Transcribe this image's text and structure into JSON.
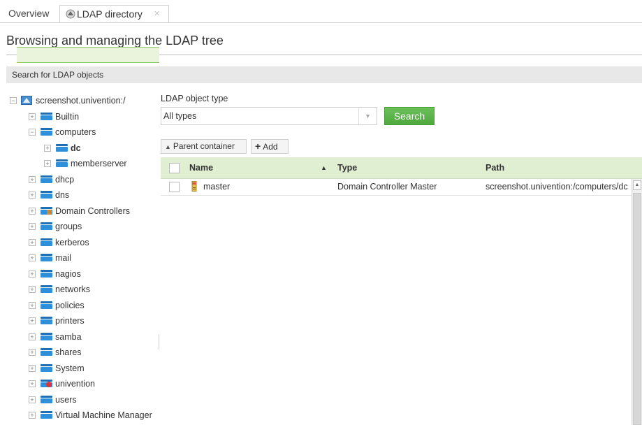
{
  "tabs": {
    "overview_label": "Overview",
    "ldap_label": "LDAP directory",
    "close_symbol": "×"
  },
  "page": {
    "title": "Browsing and managing the LDAP tree",
    "section_title": "Search for LDAP objects"
  },
  "tree": {
    "root": "screenshot.univention:/",
    "items": [
      {
        "label": "Builtin",
        "expander": "+",
        "icon": "container-icon"
      },
      {
        "label": "computers",
        "expander": "−",
        "icon": "container-icon"
      },
      {
        "label": "dc",
        "expander": "+",
        "icon": "container-icon",
        "selected": true
      },
      {
        "label": "memberserver",
        "expander": "+",
        "icon": "container-icon"
      },
      {
        "label": "dhcp",
        "expander": "+",
        "icon": "container-icon"
      },
      {
        "label": "dns",
        "expander": "+",
        "icon": "container-icon"
      },
      {
        "label": "Domain Controllers",
        "expander": "+",
        "icon": "domain-controllers-icon"
      },
      {
        "label": "groups",
        "expander": "+",
        "icon": "container-icon"
      },
      {
        "label": "kerberos",
        "expander": "+",
        "icon": "container-icon"
      },
      {
        "label": "mail",
        "expander": "+",
        "icon": "container-icon"
      },
      {
        "label": "nagios",
        "expander": "+",
        "icon": "container-icon"
      },
      {
        "label": "networks",
        "expander": "+",
        "icon": "container-icon"
      },
      {
        "label": "policies",
        "expander": "+",
        "icon": "container-icon"
      },
      {
        "label": "printers",
        "expander": "+",
        "icon": "container-icon"
      },
      {
        "label": "samba",
        "expander": "+",
        "icon": "container-icon"
      },
      {
        "label": "shares",
        "expander": "+",
        "icon": "container-icon"
      },
      {
        "label": "System",
        "expander": "+",
        "icon": "container-icon"
      },
      {
        "label": "univention",
        "expander": "+",
        "icon": "univention-container-icon"
      },
      {
        "label": "users",
        "expander": "+",
        "icon": "container-icon"
      },
      {
        "label": "Virtual Machine Manager",
        "expander": "+",
        "icon": "container-icon"
      }
    ]
  },
  "search": {
    "object_type_label": "LDAP object type",
    "object_type_value": "All types",
    "search_button": "Search"
  },
  "toolbar": {
    "parent_container": "Parent container",
    "add": "Add"
  },
  "grid": {
    "columns": {
      "name": "Name",
      "type": "Type",
      "path": "Path"
    },
    "sort_indicator": "▲",
    "rows": [
      {
        "name": "master",
        "type": "Domain Controller Master",
        "path": "screenshot.univention:/computers/dc"
      }
    ]
  },
  "colors": {
    "accent_green": "#4fa83e",
    "header_green": "#e0eed2",
    "selection_green": "#eaf4dd",
    "container_blue": "#2f8fd8"
  }
}
